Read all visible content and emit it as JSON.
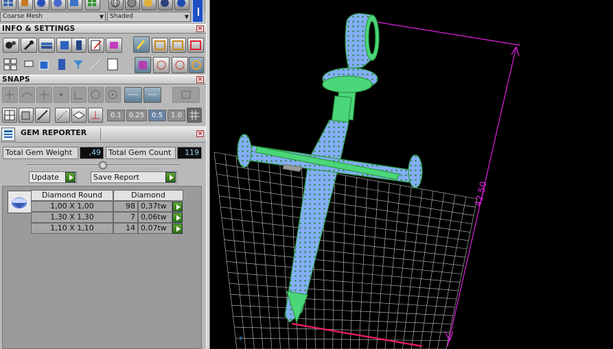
{
  "toolbar": {
    "mesh_dropdown": "Coarse Mesh",
    "shade_dropdown": "Shaded"
  },
  "sections": {
    "info_settings": "INFO & SETTINGS",
    "snaps": "SNAPS"
  },
  "snaps": {
    "values": [
      "0.1",
      "0.25",
      "0.5",
      "1.0"
    ],
    "selected": "0.5"
  },
  "gem_reporter": {
    "title": "GEM REPORTER",
    "total_weight_label": "Total Gem Weight",
    "total_weight_value": ",49",
    "total_count_label": "Total Gem Count",
    "total_count_value": "119",
    "update_label": "Update",
    "save_report_label": "Save Report",
    "table": {
      "header_cut": "Diamond Round",
      "header_material": "Diamond",
      "rows": [
        {
          "size": "1,00 X 1,00",
          "count": "98",
          "weight": "0,37tw"
        },
        {
          "size": "1,30 X 1,30",
          "count": "7",
          "weight": "0,06tw"
        },
        {
          "size": "1,10 X 1,10",
          "count": "14",
          "weight": "0,07tw"
        }
      ]
    }
  },
  "viewport": {
    "dimension_label": "42.50",
    "model_color": "#4cd67a",
    "gem_color": "#8fb7ff",
    "dimension_color": "#e020e0",
    "grid_color": "#c8c8c8"
  },
  "colors": {
    "panel_bg": "#b9b9b9",
    "section_close": "#b22222",
    "play_green": "#3f8a1c",
    "value_text": "#8fd3f0"
  }
}
